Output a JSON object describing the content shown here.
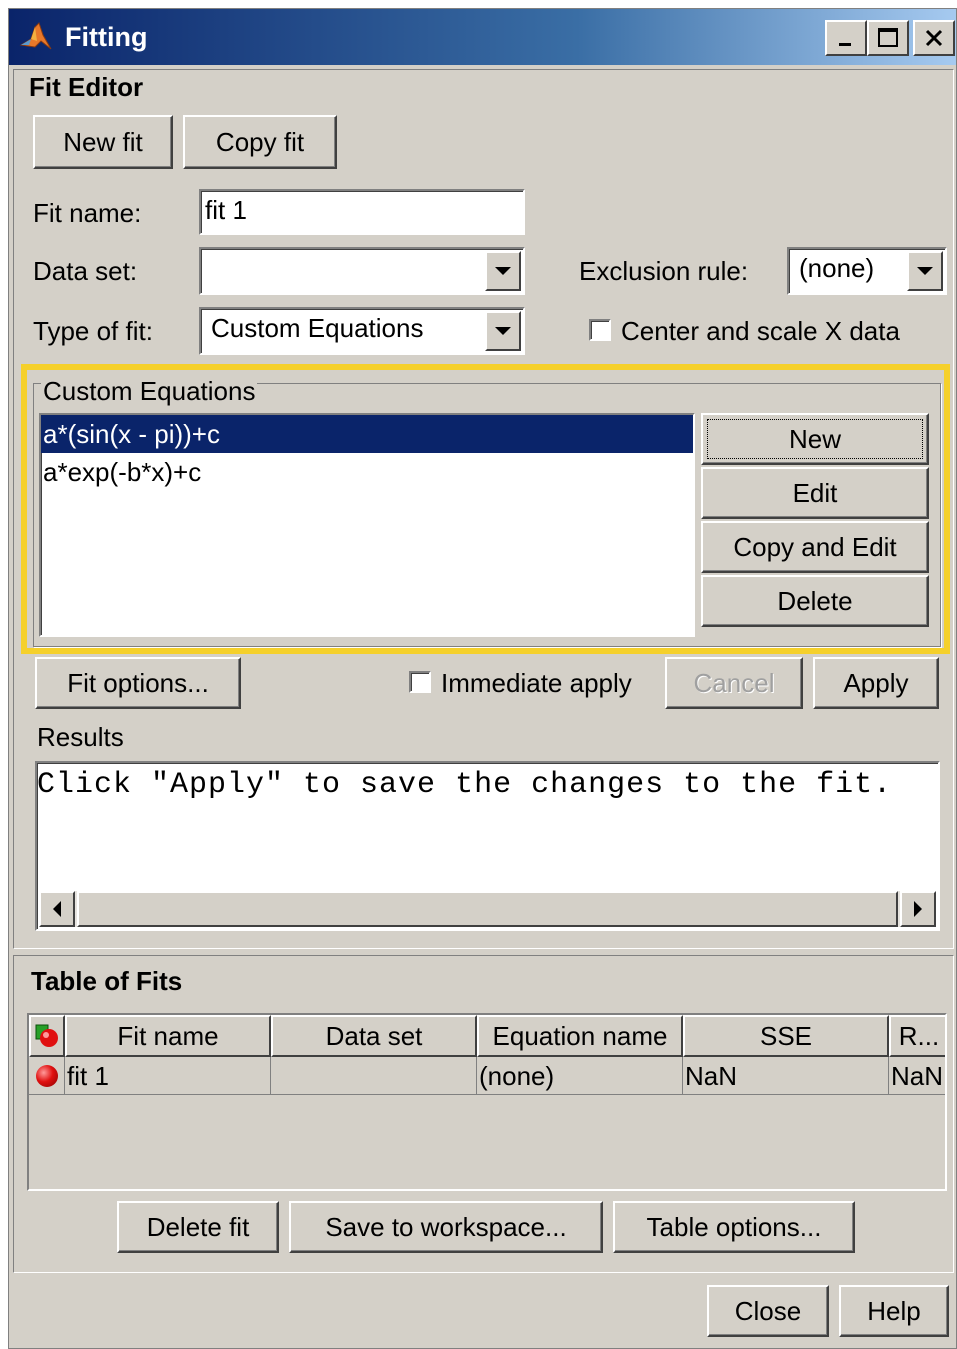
{
  "window": {
    "title": "Fitting"
  },
  "fit_editor": {
    "heading": "Fit Editor",
    "new_fit_label": "New fit",
    "copy_fit_label": "Copy fit",
    "fit_name_label": "Fit name:",
    "fit_name_value": "fit 1",
    "data_set_label": "Data set:",
    "data_set_value": "",
    "exclusion_rule_label": "Exclusion rule:",
    "exclusion_rule_value": "(none)",
    "type_of_fit_label": "Type of fit:",
    "type_of_fit_value": "Custom Equations",
    "center_scale_label": "Center and scale X data",
    "center_scale_checked": false
  },
  "custom_equations": {
    "legend": "Custom Equations",
    "items": [
      {
        "label": "a*(sin(x - pi))+c",
        "selected": true
      },
      {
        "label": "a*exp(-b*x)+c",
        "selected": false
      }
    ],
    "new_label": "New",
    "edit_label": "Edit",
    "copy_edit_label": "Copy and Edit",
    "delete_label": "Delete"
  },
  "actions": {
    "fit_options_label": "Fit options...",
    "immediate_apply_label": "Immediate apply",
    "immediate_apply_checked": false,
    "cancel_label": "Cancel",
    "apply_label": "Apply"
  },
  "results": {
    "label": "Results",
    "text": "Click \"Apply\" to save the changes to the fit."
  },
  "table_of_fits": {
    "heading": "Table of Fits",
    "columns": [
      "Fit name",
      "Data set",
      "Equation name",
      "SSE",
      "R..."
    ],
    "rows": [
      {
        "fit_name": "fit 1",
        "data_set": "",
        "equation_name": "(none)",
        "sse": "NaN",
        "r": "NaN"
      }
    ],
    "delete_fit_label": "Delete fit",
    "save_workspace_label": "Save to workspace...",
    "table_options_label": "Table options..."
  },
  "footer": {
    "close_label": "Close",
    "help_label": "Help"
  },
  "colors": {
    "highlight": "#f5d02b",
    "selection": "#0a246a",
    "face": "#d4d0c8"
  },
  "icons": {
    "title": "matlab-membrane-icon",
    "table_header": "fit-status-icon",
    "row_status": "red-ball-icon"
  }
}
